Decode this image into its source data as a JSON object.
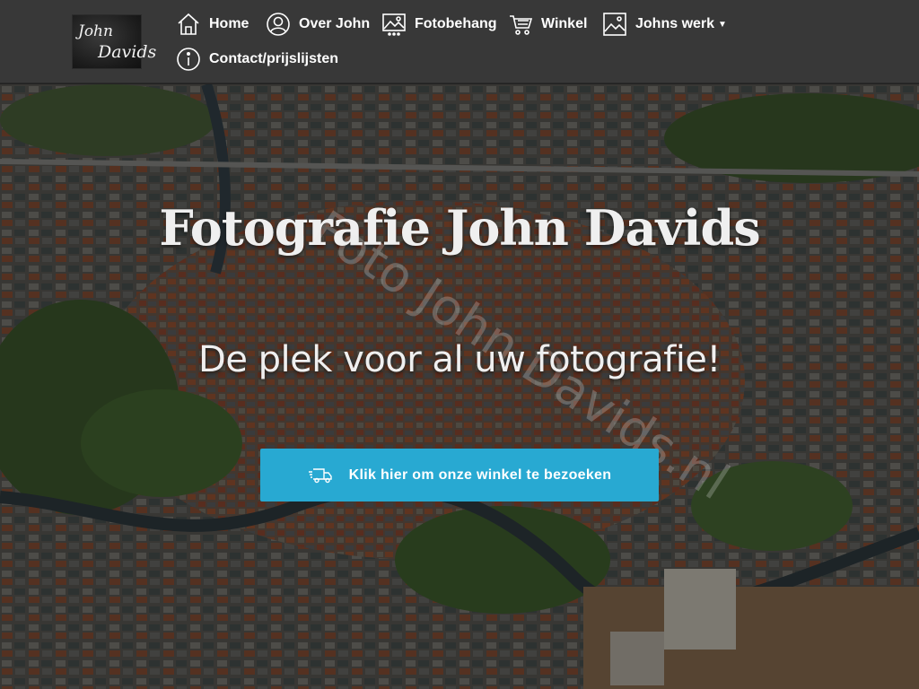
{
  "logo": {
    "line1": "John",
    "line2": "Davids"
  },
  "nav": {
    "home": {
      "label": "Home",
      "icon": "home-icon"
    },
    "about": {
      "label": "Over John",
      "icon": "user-icon"
    },
    "wallpaper": {
      "label": "Fotobehang",
      "icon": "image-icon"
    },
    "shop": {
      "label": "Winkel",
      "icon": "cart-icon"
    },
    "work": {
      "label": "Johns werk",
      "icon": "picture-icon",
      "has_dropdown": true
    },
    "contact": {
      "label": "Contact/prijslijsten",
      "icon": "info-icon"
    }
  },
  "hero": {
    "title": "Fotografie John Davids",
    "subtitle": "De plek voor al uw fotografie!",
    "watermark": "Foto John Davids.nl",
    "button_label": "Klik hier om onze winkel te bezoeken",
    "button_icon": "delivery-truck-icon"
  },
  "colors": {
    "header_bg": "#383838",
    "button_bg": "#28a9d2",
    "text": "#ffffff"
  }
}
